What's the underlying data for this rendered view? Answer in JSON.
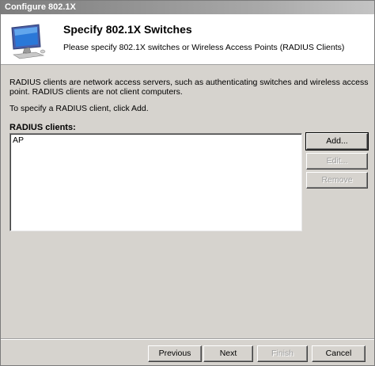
{
  "window": {
    "title": "Configure 802.1X"
  },
  "header": {
    "title": "Specify 802.1X Switches",
    "subtitle": "Please specify 802.1X switches or Wireless Access Points (RADIUS Clients)",
    "icon": "computer-monitor-icon"
  },
  "content": {
    "description": "RADIUS clients are network access servers, such as authenticating switches and wireless access point. RADIUS clients are not client computers.",
    "instruction": "To specify a RADIUS client, click Add.",
    "list_label": "RADIUS clients:",
    "clients": [
      "AP"
    ]
  },
  "side_buttons": {
    "add": "Add...",
    "edit": "Edit...",
    "remove": "Remove"
  },
  "footer": {
    "previous": "Previous",
    "next": "Next",
    "finish": "Finish",
    "cancel": "Cancel"
  },
  "colors": {
    "dialog_bg": "#d6d3ce",
    "header_bg": "#ffffff",
    "disabled_text": "#a0a0a0"
  }
}
